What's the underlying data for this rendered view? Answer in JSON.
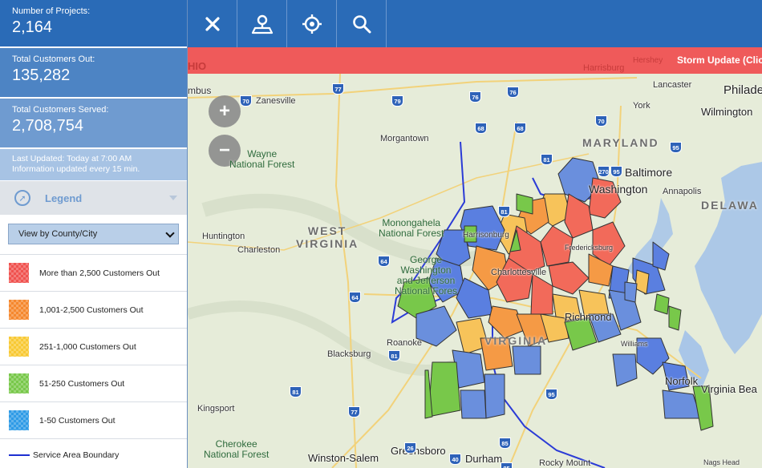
{
  "sidebar": {
    "projects": {
      "label": "Number of Projects:",
      "value": "2,164"
    },
    "customers_out": {
      "label": "Total Customers Out:",
      "value": "135,282"
    },
    "customers_served": {
      "label": "Total Customers Served:",
      "value": "2,708,754"
    },
    "last_updated": "Last Updated: Today at 7:00 AM",
    "update_freq": "Information updated every 15 min.",
    "legend_title": "Legend",
    "view_select": "View by County/City",
    "legend_items": [
      {
        "label": "More than 2,500 Customers Out",
        "color": "#f0524f"
      },
      {
        "label": "1,001-2,500 Customers Out",
        "color": "#f5882e"
      },
      {
        "label": "251-1,000 Customers Out",
        "color": "#f8c934"
      },
      {
        "label": "51-250 Customers Out",
        "color": "#78c84a"
      },
      {
        "label": "1-50 Customers Out",
        "color": "#2f9be6"
      }
    ],
    "boundary_label": "Service Area Boundary"
  },
  "toolbar": {
    "buttons": [
      "close-icon",
      "map-user-icon",
      "crosshair-icon",
      "search-icon"
    ]
  },
  "banner": {
    "text": "Storm Update (Clic",
    "ghost_left": "HIO",
    "ghost_a": "Hershey",
    "ghost_b": "Harrisburg"
  },
  "map": {
    "zoom_in": "+",
    "zoom_out": "−",
    "states": {
      "wv": "WEST\nVIRGINIA",
      "md": "MARYLAND",
      "de": "DELAWA",
      "va": "VIRGINIA"
    },
    "forests": {
      "wayne": "Wayne\nNational Forest",
      "monongahela": "Monongahela\nNational Forest",
      "gw": "George\nWashington\nand Jefferson\nNational Fores"
    },
    "places": {
      "columbus": "mbus",
      "zanesville": "Zanesville",
      "morgantown": "Morgantown",
      "harrisburg": "Harrisburg",
      "lancaster": "Lancaster",
      "york": "York",
      "philadelphia": "Philade",
      "wilmington": "Wilmington",
      "baltimore": "Baltimore",
      "washington": "Washington",
      "annapolis": "Annapolis",
      "huntington": "Huntington",
      "charleston": "Charleston",
      "harrisonburg": "Harrisonburg",
      "charlottesville": "Charlottesville",
      "richmond": "Richmond",
      "fredericksburg": "Fredericksburg",
      "roanoke": "Roanoke",
      "blacksburg": "Blacksburg",
      "williamsburg": "Williams",
      "norfolk": "Norfolk",
      "virginia_beach": "Virginia Bea",
      "kingsport": "Kingsport",
      "cherokee": "Cherokee\nNational Forest",
      "winston_salem": "Winston-Salem",
      "greensboro": "Greensboro",
      "durham": "Durham",
      "rocky_mount": "Rocky Mount",
      "nags_head": "Nags Head"
    },
    "highway_shields": [
      "70",
      "77",
      "79",
      "76",
      "76",
      "68",
      "68",
      "70",
      "270",
      "95",
      "95",
      "81",
      "81",
      "64",
      "64",
      "81",
      "77",
      "81",
      "26",
      "85",
      "85",
      "40",
      "95"
    ]
  }
}
